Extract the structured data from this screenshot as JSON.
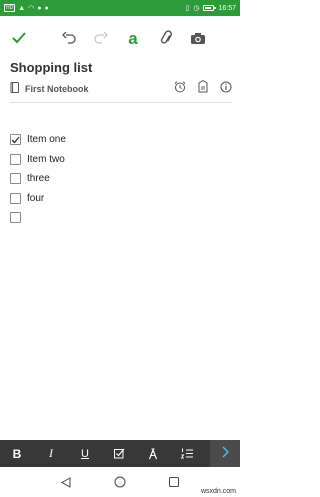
{
  "status_bar": {
    "time": "16:57",
    "hd_label": "HD"
  },
  "toolbar": {
    "done_icon": "check-icon",
    "undo_icon": "undo-icon",
    "redo_icon": "redo-icon",
    "format_icon": "text-format-icon",
    "format_glyph": "a",
    "attach_icon": "paperclip-icon",
    "camera_icon": "camera-icon"
  },
  "note": {
    "title": "Shopping list",
    "notebook": "First Notebook",
    "checklist": [
      {
        "text": "Item one",
        "checked": true
      },
      {
        "text": "Item two",
        "checked": false
      },
      {
        "text": "three",
        "checked": false
      },
      {
        "text": "four",
        "checked": false
      },
      {
        "text": "",
        "checked": false
      }
    ]
  },
  "format_bar": {
    "bold": "B",
    "italic": "I",
    "underline": "U"
  },
  "watermark": "wsxdn.com",
  "colors": {
    "accent": "#2d9b3a",
    "format_bar_bg": "#383838"
  }
}
